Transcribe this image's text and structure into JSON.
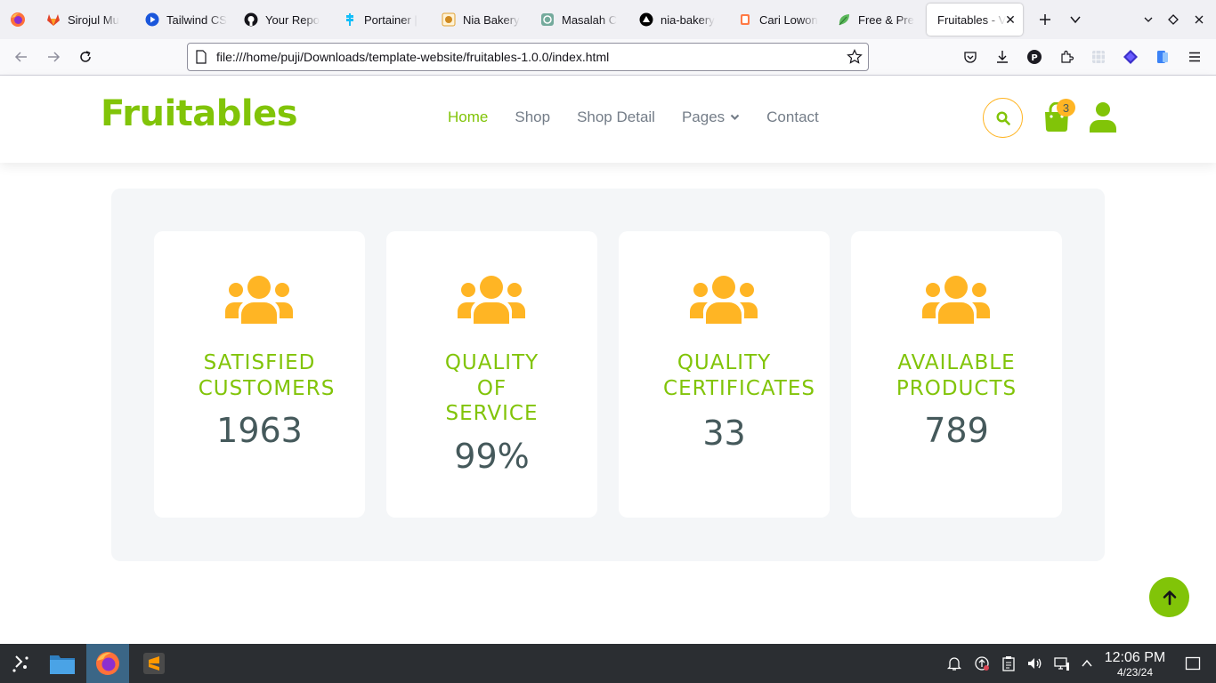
{
  "browser": {
    "tabs": [
      {
        "title": "Sirojul Mu",
        "icon": "gitlab-icon"
      },
      {
        "title": "Tailwind CS",
        "icon": "play-icon"
      },
      {
        "title": "Your Repo",
        "icon": "github-icon"
      },
      {
        "title": "Portainer |",
        "icon": "portainer-icon"
      },
      {
        "title": "Nia Bakery",
        "icon": "bakery-icon"
      },
      {
        "title": "Masalah C",
        "icon": "chatgpt-icon"
      },
      {
        "title": "nia-bakery",
        "icon": "vercel-icon"
      },
      {
        "title": "Cari Lowon",
        "icon": "job-icon"
      },
      {
        "title": "Free & Pre",
        "icon": "leaf-icon"
      },
      {
        "title": "Fruitables - V",
        "icon": "none",
        "active": true
      }
    ],
    "url": "file:///home/puji/Downloads/template-website/fruitables-1.0.0/index.html"
  },
  "site": {
    "logo": "Fruitables",
    "nav": [
      {
        "label": "Home",
        "active": true
      },
      {
        "label": "Shop"
      },
      {
        "label": "Shop Detail"
      },
      {
        "label": "Pages",
        "dropdown": true
      },
      {
        "label": "Contact"
      }
    ],
    "cart_count": "3",
    "colors": {
      "primary": "#81c408",
      "secondary": "#ffb524",
      "dark": "#45595b",
      "light": "#f4f6f8"
    }
  },
  "stats": [
    {
      "label_lines": [
        "SATISFIED",
        "CUSTOMERS"
      ],
      "value": "1963",
      "icon": "users-icon"
    },
    {
      "label_lines": [
        "QUALITY",
        "OF",
        "SERVICE"
      ],
      "value": "99%",
      "icon": "users-icon"
    },
    {
      "label_lines": [
        "QUALITY",
        "CERTIFICATES"
      ],
      "value": "33",
      "icon": "users-icon"
    },
    {
      "label_lines": [
        "AVAILABLE",
        "PRODUCTS"
      ],
      "value": "789",
      "icon": "users-icon"
    }
  ],
  "taskbar": {
    "time": "12:06 PM",
    "date": "4/23/24"
  }
}
